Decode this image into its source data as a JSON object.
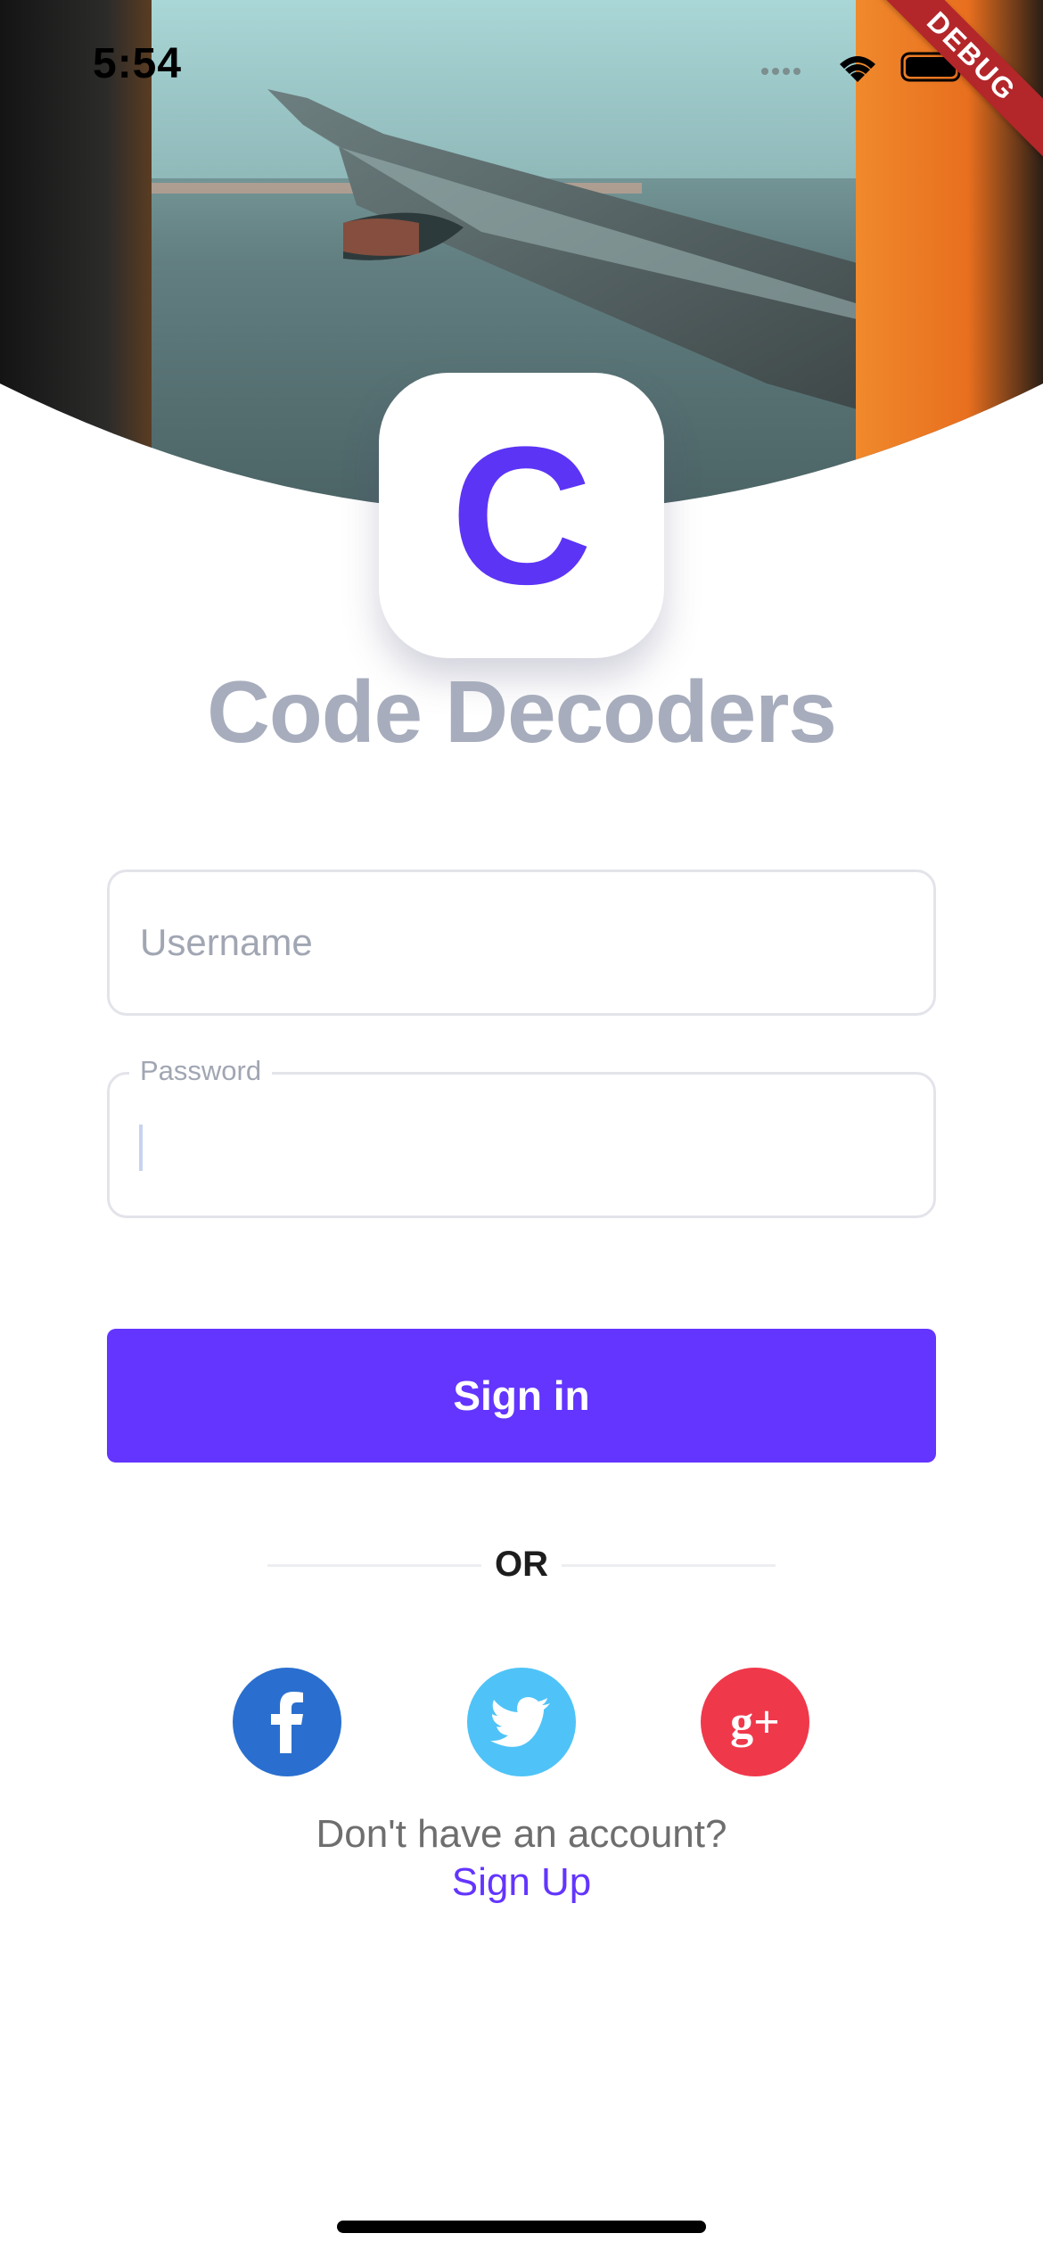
{
  "status_bar": {
    "time": "5:54",
    "debug_label": "DEBUG"
  },
  "hero": {
    "image": "airplane-wing-window-photo"
  },
  "logo": {
    "letter": "C",
    "app_name": "Code Decoders",
    "accent_color": "#5c34f5"
  },
  "form": {
    "username_placeholder": "Username",
    "password_label": "Password",
    "password_value": ""
  },
  "signin_button": {
    "label": "Sign in",
    "color": "#6335ff"
  },
  "divider": {
    "label": "OR"
  },
  "social": [
    {
      "name": "facebook",
      "icon": "facebook-icon",
      "color": "#2a6fcf"
    },
    {
      "name": "twitter",
      "icon": "twitter-icon",
      "color": "#4fc3f7"
    },
    {
      "name": "google-plus",
      "icon": "google-plus-icon",
      "color": "#f0384b"
    }
  ],
  "footer": {
    "no_account_text": "Don't have an account?",
    "signup_label": "Sign Up"
  }
}
